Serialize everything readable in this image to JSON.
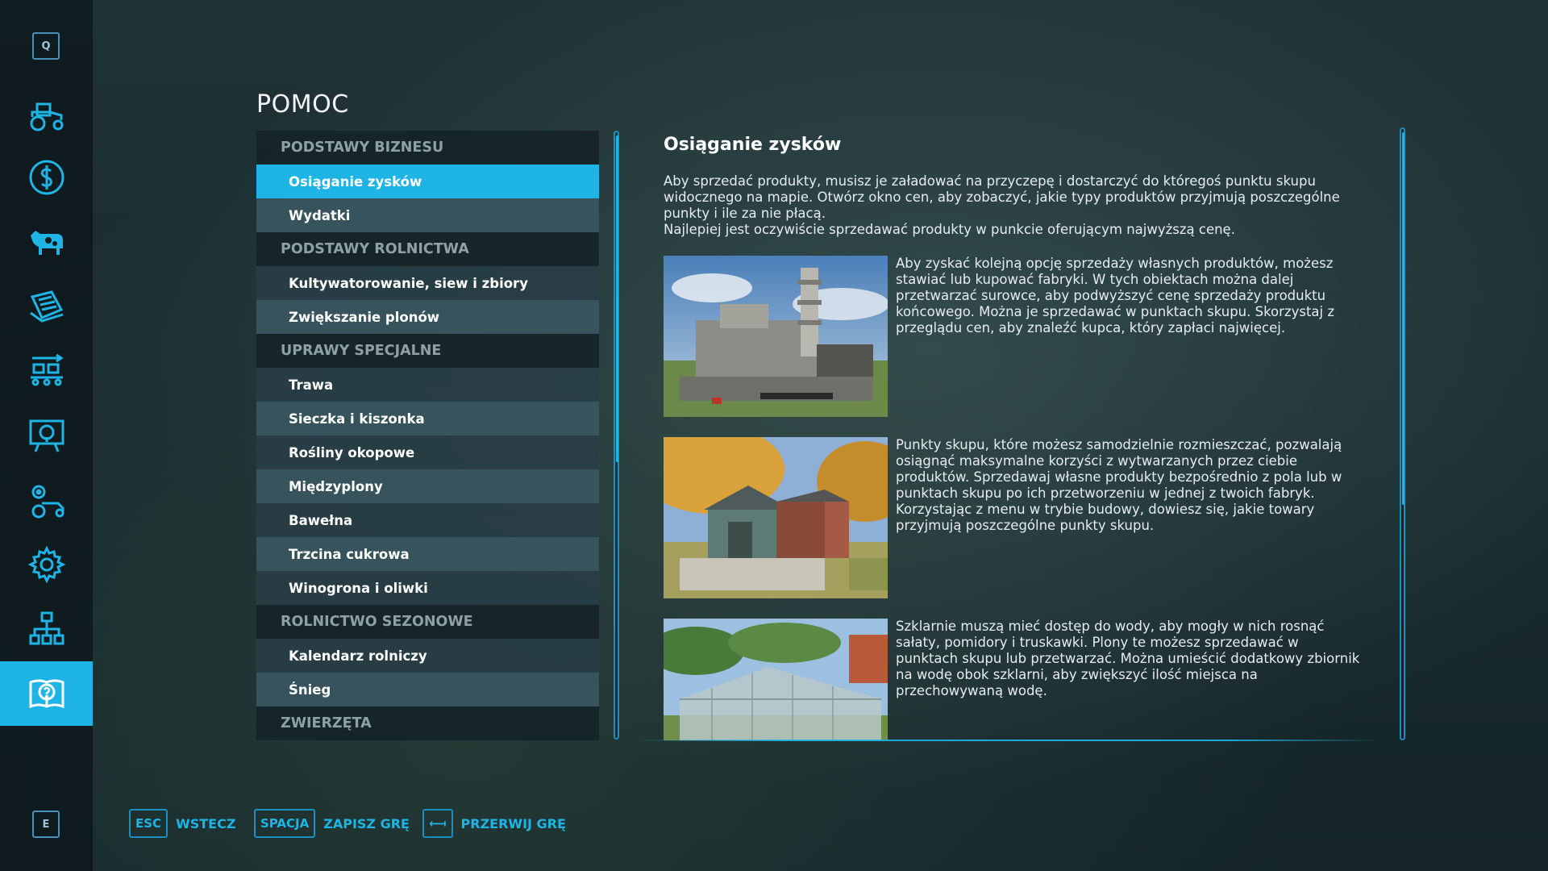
{
  "sidebar": {
    "top_key": "Q",
    "bottom_key": "E",
    "icons": [
      {
        "name": "tractor-icon"
      },
      {
        "name": "dollar-icon"
      },
      {
        "name": "cow-icon"
      },
      {
        "name": "contracts-icon"
      },
      {
        "name": "production-icon"
      },
      {
        "name": "tour-icon"
      },
      {
        "name": "vehicle-settings-icon"
      },
      {
        "name": "gear-icon"
      },
      {
        "name": "network-icon"
      },
      {
        "name": "help-book-icon",
        "active": true
      }
    ]
  },
  "page": {
    "title": "POMOC"
  },
  "categories": [
    {
      "type": "header",
      "label": "PODSTAWY BIZNESU"
    },
    {
      "type": "item",
      "label": "Osiąganie zysków",
      "selected": true
    },
    {
      "type": "item",
      "label": "Wydatki"
    },
    {
      "type": "header",
      "label": "PODSTAWY ROLNICTWA"
    },
    {
      "type": "item",
      "label": "Kultywatorowanie, siew i zbiory"
    },
    {
      "type": "item",
      "label": "Zwiększanie plonów"
    },
    {
      "type": "header",
      "label": "UPRAWY SPECJALNE"
    },
    {
      "type": "item",
      "label": "Trawa"
    },
    {
      "type": "item",
      "label": "Sieczka i kiszonka"
    },
    {
      "type": "item",
      "label": "Rośliny okopowe"
    },
    {
      "type": "item",
      "label": "Międzyplony"
    },
    {
      "type": "item",
      "label": "Bawełna"
    },
    {
      "type": "item",
      "label": "Trzcina cukrowa"
    },
    {
      "type": "item",
      "label": "Winogrona i oliwki"
    },
    {
      "type": "header",
      "label": "ROLNICTWO SEZONOWE"
    },
    {
      "type": "item",
      "label": "Kalendarz rolniczy"
    },
    {
      "type": "item",
      "label": "Śnieg"
    },
    {
      "type": "header",
      "label": "ZWIERZĘTA"
    }
  ],
  "content": {
    "title": "Osiąganie zysków",
    "intro": "Aby sprzedać produkty, musisz je załadować na przyczepę i dostarczyć do któregoś punktu skupu widocznego na mapie. Otwórz okno cen, aby zobaczyć, jakie typy produktów przyjmują poszczególne punkty i ile za nie płacą.",
    "intro2": "Najlepiej jest oczywiście sprzedawać produkty w punkcie oferującym najwyższą cenę.",
    "entries": [
      {
        "image": "factory",
        "text": "Aby zyskać kolejną opcję sprzedaży własnych produktów, możesz stawiać lub kupować fabryki. W tych obiektach można dalej przetwarzać surowce, aby podwyższyć cenę sprzedaży produktu końcowego. Można je sprzedawać w punktach skupu. Skorzystaj z przeglądu cen, aby znaleźć kupca, który zapłaci najwięcej."
      },
      {
        "image": "farm-shop",
        "text": "Punkty skupu, które możesz samodzielnie rozmieszczać, pozwalają osiągnąć maksymalne korzyści z wytwarzanych przez ciebie produktów. Sprzedawaj własne produkty bezpośrednio z pola lub w punktach skupu po ich przetworzeniu w jednej z twoich fabryk. Korzystając z menu w trybie budowy, dowiesz się, jakie towary przyjmują poszczególne punkty skupu."
      },
      {
        "image": "greenhouse",
        "text": "Szklarnie muszą mieć dostęp do wody, aby mogły w nich rosnąć sałaty, pomidory i truskawki. Plony te możesz sprzedawać w punktach skupu lub przetwarzać. Można umieścić dodatkowy zbiornik na wodę obok szklarni, aby zwiększyć ilość miejsca na przechowywaną wodę."
      }
    ]
  },
  "footer": {
    "back": {
      "key": "ESC",
      "label": "WSTECZ"
    },
    "save": {
      "key": "SPACJA",
      "label": "ZAPISZ GRĘ"
    },
    "quit": {
      "key": "⟻",
      "label": "PRZERWIJ GRĘ"
    }
  },
  "colors": {
    "accent": "#1eb5e6",
    "header_bg": "#162428",
    "item_bg_light": "#3a5862",
    "item_bg_dark": "#283e46"
  }
}
